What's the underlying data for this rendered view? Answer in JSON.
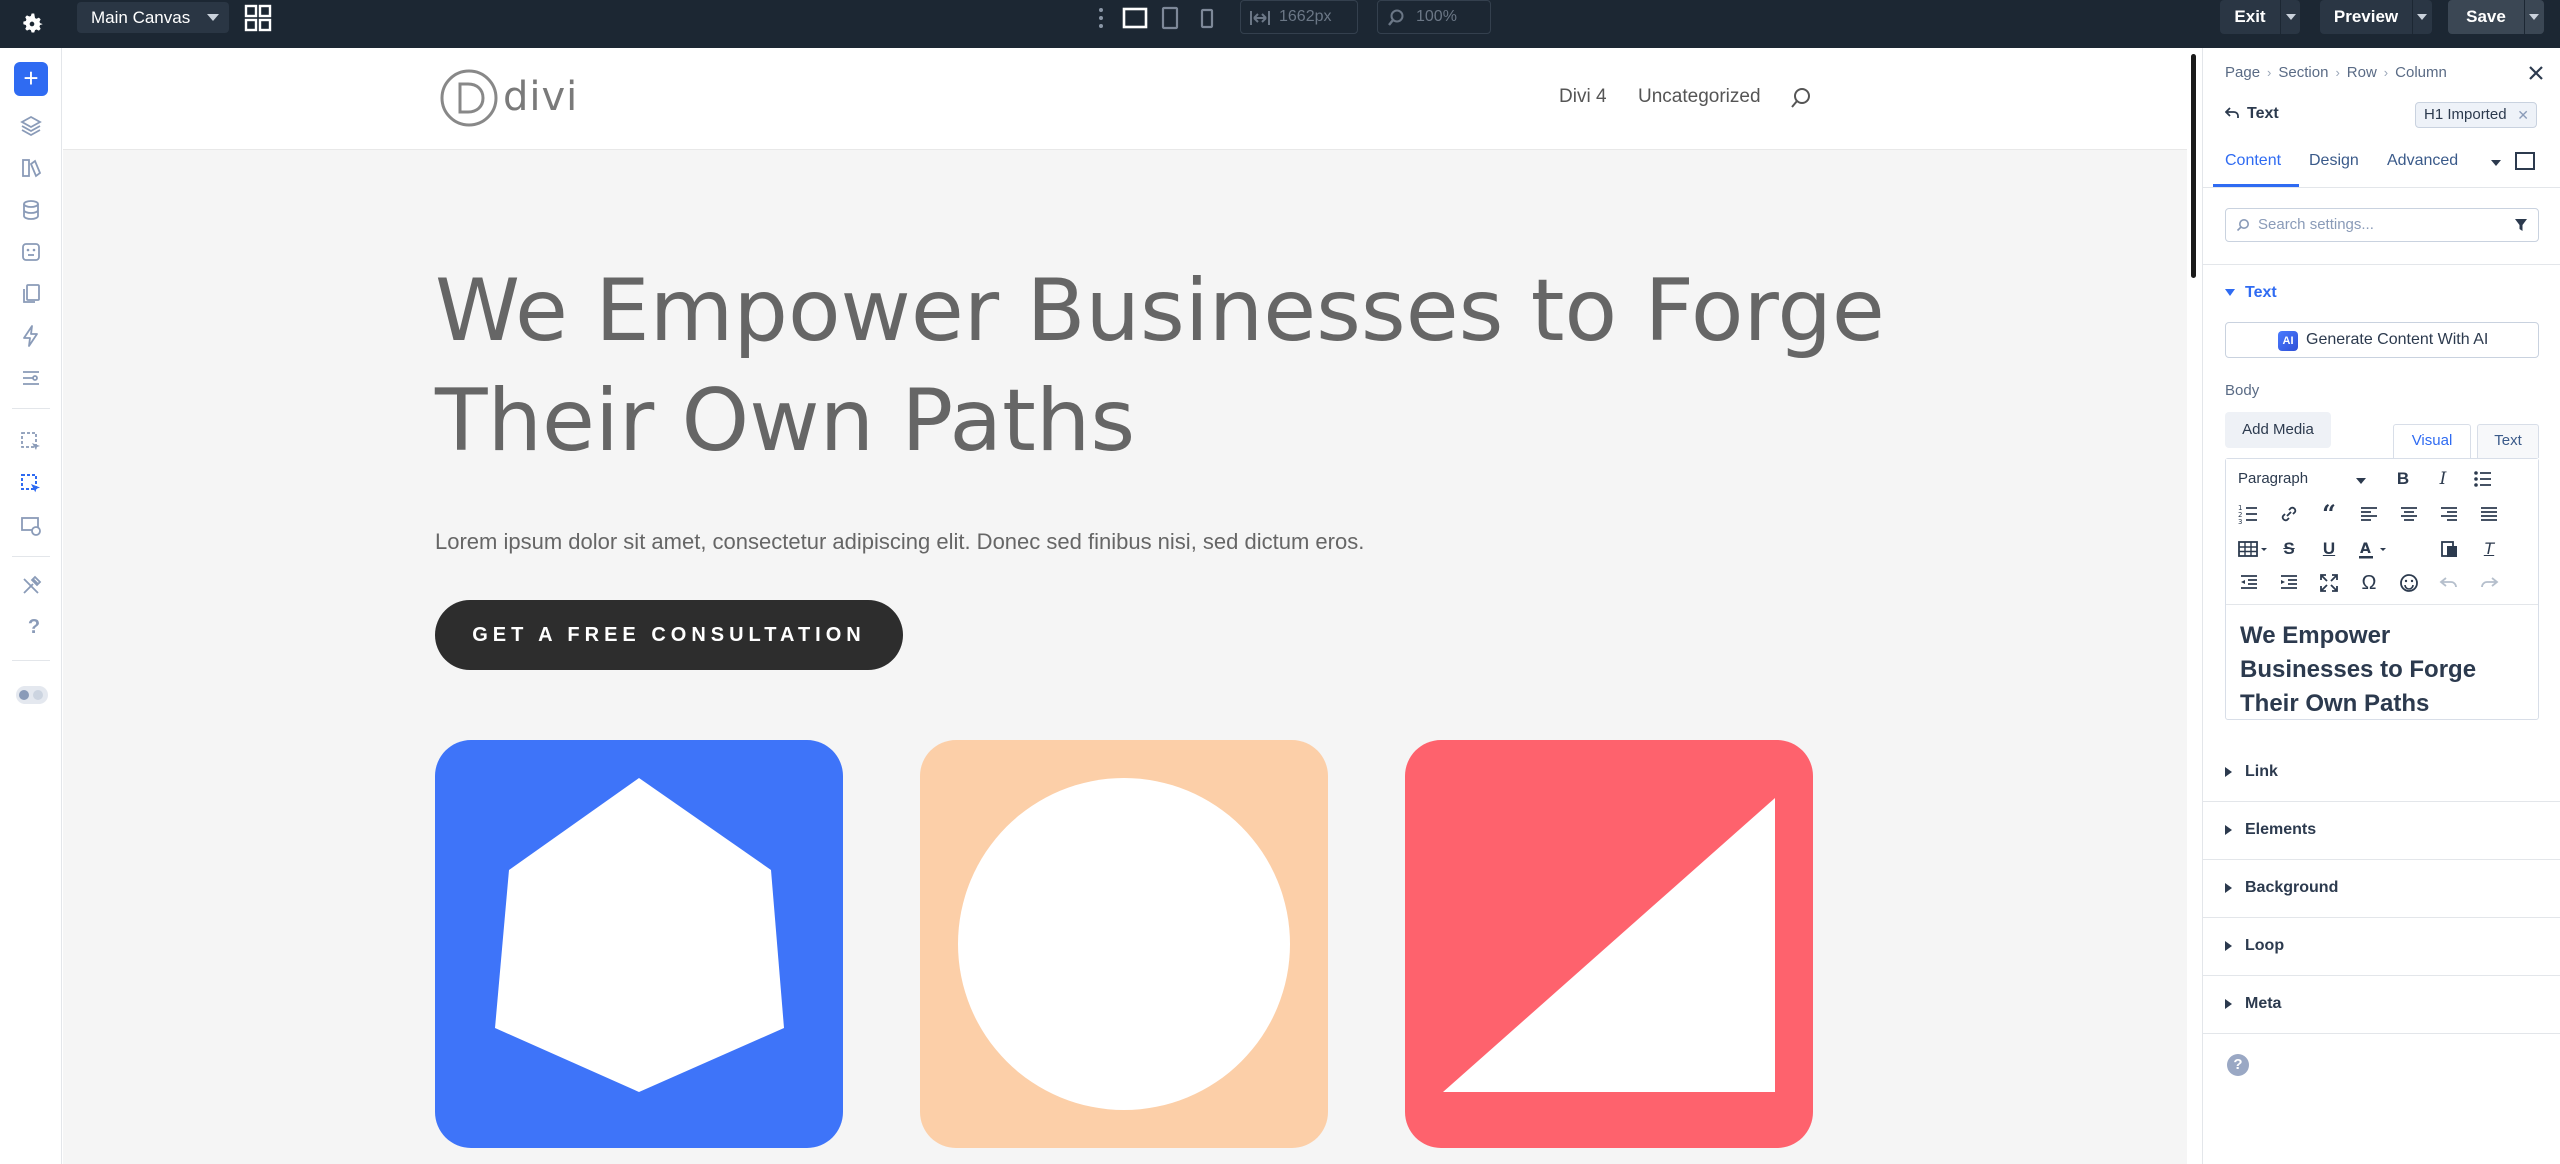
{
  "topbar": {
    "canvas_selector": "Main Canvas",
    "width_value": "1662px",
    "zoom_value": "100%",
    "exit_label": "Exit",
    "preview_label": "Preview",
    "save_label": "Save"
  },
  "site": {
    "logo_text": "divi",
    "nav": [
      "Divi 4",
      "Uncategorized"
    ],
    "hero_title": "We Empower Businesses to Forge Their Own Paths",
    "hero_subtitle": "Lorem ipsum dolor sit amet, consectetur adipiscing elit. Donec sed finibus nisi, sed dictum eros.",
    "cta_label": "GET A FREE CONSULTATION",
    "cards": [
      {
        "color": "#3e74f9",
        "shape": "hexagon"
      },
      {
        "color": "#fccfa8",
        "shape": "circle"
      },
      {
        "color": "#fe626d",
        "shape": "triangle"
      }
    ]
  },
  "panel": {
    "breadcrumbs": [
      "Page",
      "Section",
      "Row",
      "Column"
    ],
    "module_name": "Text",
    "preset": "H1 Imported",
    "tabs": [
      "Content",
      "Design",
      "Advanced"
    ],
    "search_placeholder": "Search settings...",
    "open_group": "Text",
    "ai_button": "Generate Content With AI",
    "body_label": "Body",
    "add_media": "Add Media",
    "editor_tabs": [
      "Visual",
      "Text"
    ],
    "paragraph_select": "Paragraph",
    "editor_content": "We Empower Businesses to Forge Their Own Paths",
    "groups": [
      "Link",
      "Elements",
      "Background",
      "Loop",
      "Meta"
    ]
  },
  "colors": {
    "accent": "#2f6bf2",
    "topbar": "#1c2733"
  }
}
